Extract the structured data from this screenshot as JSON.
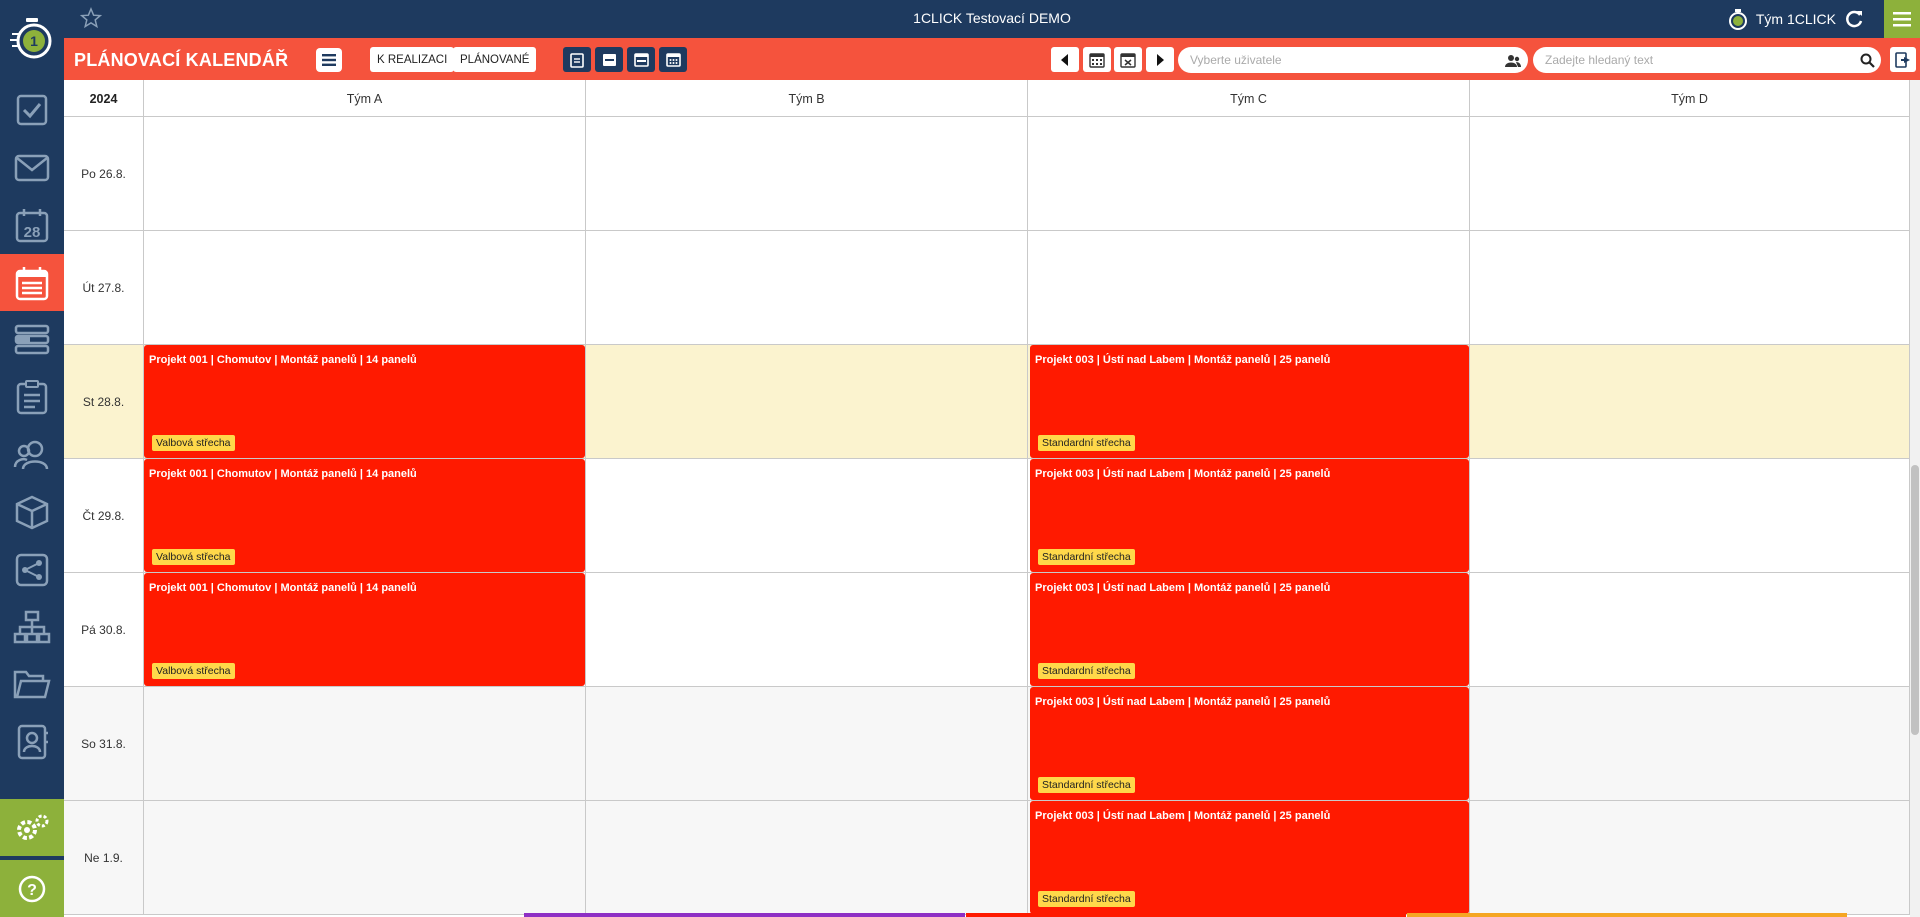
{
  "colors": {
    "sidebar": "#1e3a5f",
    "accent": "#f5533d",
    "green": "#8db13b",
    "event": "#ff1a00",
    "tag": "#ffd84a",
    "today": "#fbf3cf"
  },
  "sidebar": {
    "logo_icon": "stopwatch-logo-icon",
    "items": [
      {
        "icon": "checkbox-icon"
      },
      {
        "icon": "mail-icon"
      },
      {
        "icon": "calendar-28-icon",
        "text": "28"
      },
      {
        "icon": "planning-calendar-icon",
        "active": true
      },
      {
        "icon": "list-bars-icon"
      },
      {
        "icon": "clipboard-icon"
      },
      {
        "icon": "users-icon"
      },
      {
        "icon": "box-icon"
      },
      {
        "icon": "workflow-icon"
      },
      {
        "icon": "org-chart-icon"
      },
      {
        "icon": "folder-icon"
      },
      {
        "icon": "contact-book-icon"
      }
    ],
    "bottom": [
      {
        "icon": "settings-gears-icon"
      },
      {
        "icon": "help-icon"
      }
    ]
  },
  "header": {
    "title": "1CLICK Testovací DEMO",
    "team": "Tým 1CLICK"
  },
  "toolbar": {
    "page_title": "PLÁNOVACÍ KALENDÁŘ",
    "btn_k_realizaci": "K REALIZACI",
    "btn_planovane": "PLÁNOVANÉ",
    "user_placeholder": "Vyberte uživatele",
    "search_placeholder": "Zadejte hledaný text"
  },
  "calendar": {
    "year": "2024",
    "columns": [
      "Tým A",
      "Tým B",
      "Tým C",
      "Tým D"
    ],
    "days": [
      "Po 26.8.",
      "Út 27.8.",
      "St 28.8.",
      "Čt 29.8.",
      "Pá 30.8.",
      "So 31.8.",
      "Ne 1.9."
    ],
    "events": {
      "a": {
        "title": "Projekt 001 | Chomutov | Montáž panelů | 14 panelů",
        "tag": "Valbová střecha"
      },
      "c": {
        "title": "Projekt 003 | Ústí nad Labem | Montáž panelů | 25 panelů",
        "tag": "Standardní střecha"
      }
    }
  }
}
